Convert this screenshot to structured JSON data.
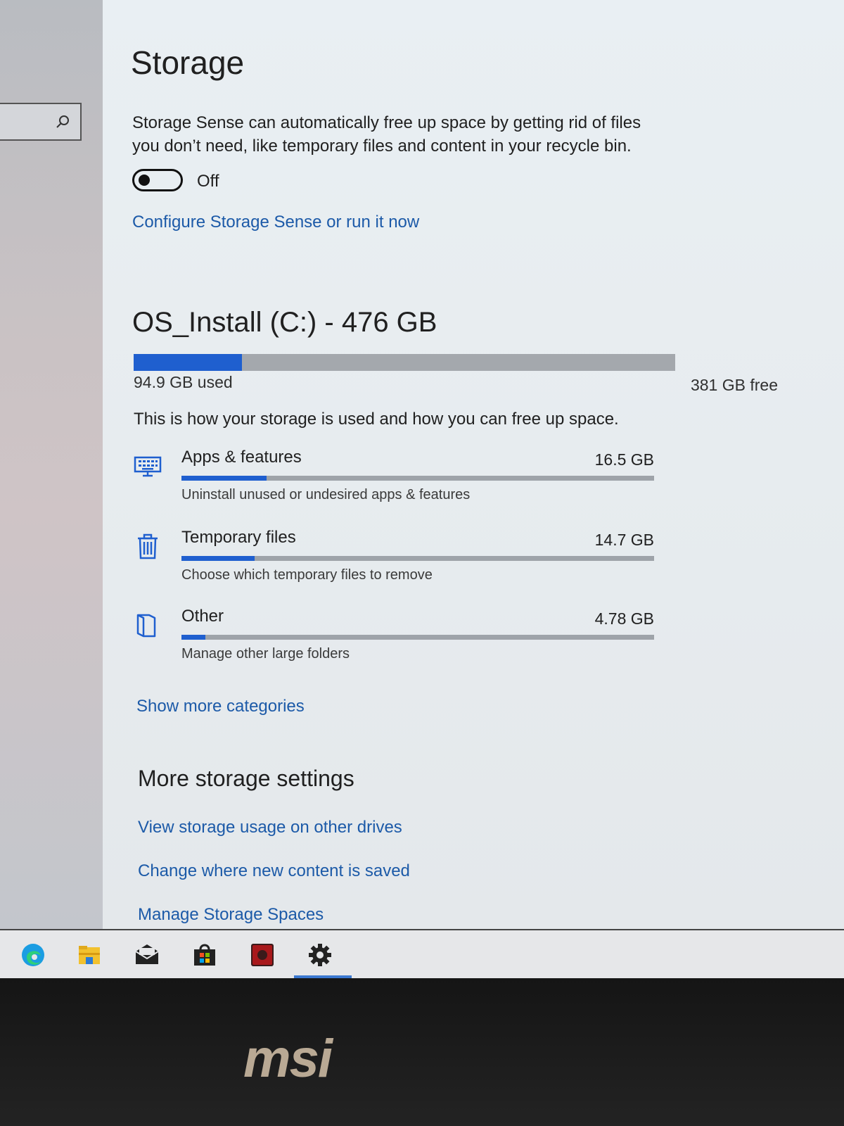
{
  "page": {
    "title": "Storage"
  },
  "storage_sense": {
    "description": "Storage Sense can automatically free up space by getting rid of files you don’t need, like temporary files and content in your recycle bin.",
    "toggle_state": "Off",
    "toggle_on": false,
    "configure_link": "Configure Storage Sense or run it now"
  },
  "drive": {
    "title": "OS_Install (C:) - 476 GB",
    "used_label": "94.9 GB used",
    "free_label": "381 GB free",
    "used_fraction": 0.2,
    "note": "This is how your storage is used and how you can free up space."
  },
  "categories": [
    {
      "name": "Apps & features",
      "size": "16.5 GB",
      "subtitle": "Uninstall unused or undesired apps & features",
      "fraction": 0.18,
      "icon": "keyboard-icon"
    },
    {
      "name": "Temporary files",
      "size": "14.7 GB",
      "subtitle": "Choose which temporary files to remove",
      "fraction": 0.155,
      "icon": "trash-icon"
    },
    {
      "name": "Other",
      "size": "4.78 GB",
      "subtitle": "Manage other large folders",
      "fraction": 0.05,
      "icon": "folder-icon"
    }
  ],
  "show_more_link": "Show more categories",
  "more_settings": {
    "title": "More storage settings",
    "links": [
      "View storage usage on other drives",
      "Change where new content is saved",
      "Manage Storage Spaces"
    ]
  },
  "taskbar": {
    "apps": [
      "edge-icon",
      "file-explorer-icon",
      "mail-icon",
      "store-icon",
      "media-app-icon",
      "settings-icon"
    ],
    "active": "settings-icon"
  },
  "bezel": {
    "brand_logo": "msi"
  },
  "colors": {
    "accent": "#1f5fcf",
    "link": "#1c5aa8",
    "bar_track": "#a4a8ad"
  }
}
